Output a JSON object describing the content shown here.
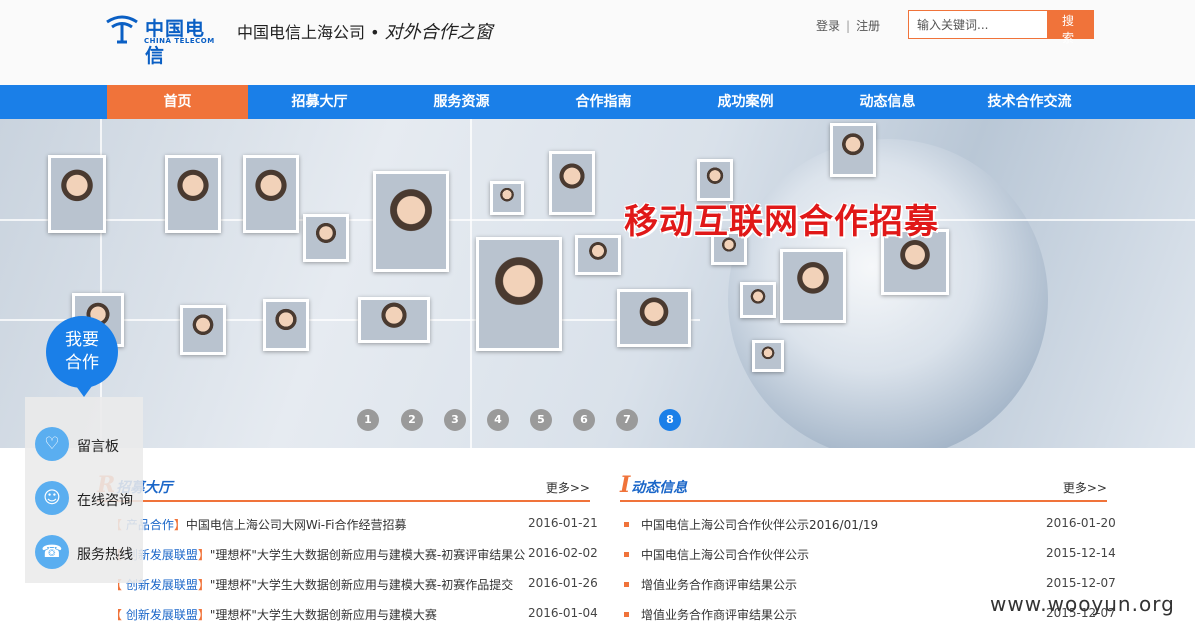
{
  "header": {
    "logo_cn": "中国电信",
    "logo_en": "CHINA TELECOM",
    "slogan_company": "中国电信上海公司",
    "slogan_dot": "•",
    "slogan_tag": "对外合作之窗",
    "login": "登录",
    "sep": "|",
    "register": "注册",
    "search_placeholder": "输入关键词...",
    "search_button": "搜 索"
  },
  "nav": [
    "首页",
    "招募大厅",
    "服务资源",
    "合作指南",
    "成功案例",
    "动态信息",
    "技术合作交流"
  ],
  "banner": {
    "title": "移动互联网合作招募",
    "pages": [
      "1",
      "2",
      "3",
      "4",
      "5",
      "6",
      "7",
      "8"
    ],
    "active_page": 8
  },
  "side": {
    "cta": [
      "我要",
      "合作"
    ],
    "items": [
      {
        "label": "留言板",
        "icon": "message-board-icon",
        "glyph": "♡"
      },
      {
        "label": "在线咨询",
        "icon": "qq-chat-icon",
        "glyph": "☺"
      },
      {
        "label": "服务热线",
        "icon": "phone-icon",
        "glyph": "☎"
      }
    ]
  },
  "recruit": {
    "cap": "R",
    "title": "招募大厅",
    "more": "更多>>",
    "rows": [
      {
        "cat": "产品合作",
        "title": "中国电信上海公司大网Wi-Fi合作经营招募",
        "date": "2016-01-21"
      },
      {
        "cat": "创新发展联盟",
        "title": "\"理想杯\"大学生大数据创新应用与建模大赛-初赛评审结果公",
        "date": "2016-02-02"
      },
      {
        "cat": "创新发展联盟",
        "title": "\"理想杯\"大学生大数据创新应用与建模大赛-初赛作品提交",
        "date": "2016-01-26"
      },
      {
        "cat": "创新发展联盟",
        "title": "\"理想杯\"大学生大数据创新应用与建模大赛",
        "date": "2016-01-04"
      }
    ]
  },
  "news": {
    "cap": "I",
    "title": "动态信息",
    "more": "更多>>",
    "rows": [
      {
        "title": "中国电信上海公司合作伙伴公示2016/01/19",
        "date": "2016-01-20"
      },
      {
        "title": "中国电信上海公司合作伙伴公示",
        "date": "2015-12-14"
      },
      {
        "title": "增值业务合作商评审结果公示",
        "date": "2015-12-07"
      },
      {
        "title": "增值业务合作商评审结果公示",
        "date": "2015-12-07"
      }
    ]
  },
  "watermark": "www.wooyun.org",
  "colors": {
    "primary": "#1a7fe8",
    "accent": "#f0733a",
    "banner_title": "#e01818"
  }
}
